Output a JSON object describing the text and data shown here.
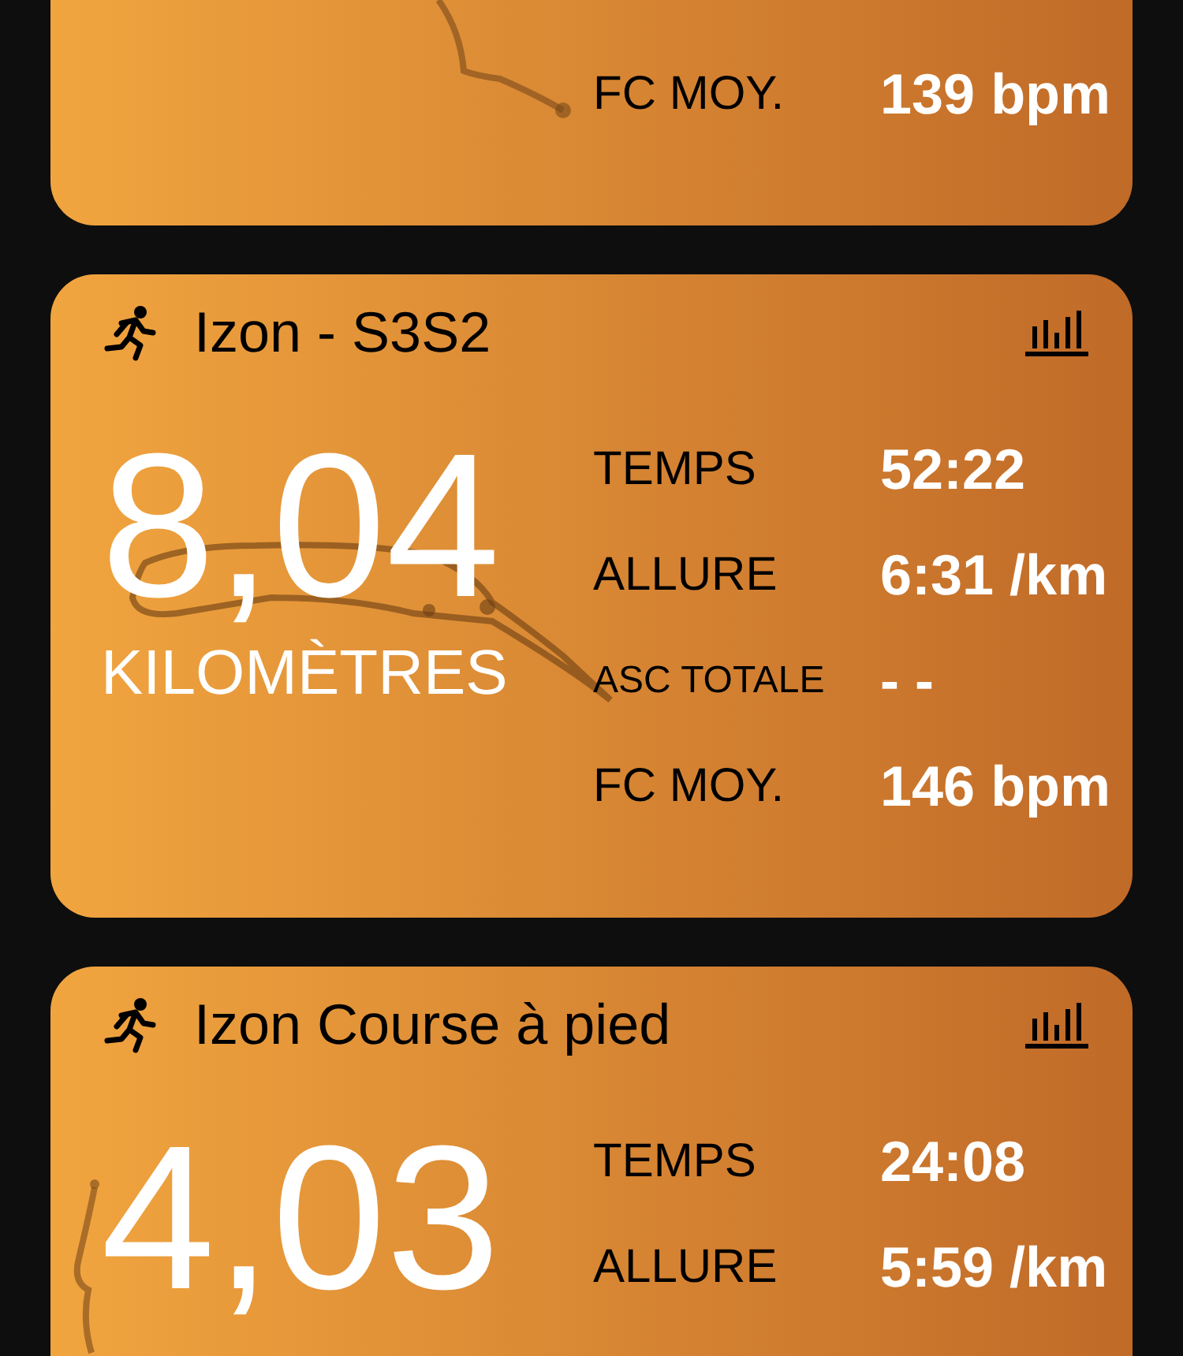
{
  "activities": [
    {
      "stats": [
        {
          "label": "FC MOY.",
          "value": "139 bpm",
          "kind": "normal"
        }
      ]
    },
    {
      "title": "Izon - S3S2",
      "distance": "8,04",
      "unit": "KILOMÈTRES",
      "stats": [
        {
          "label": "TEMPS",
          "value": "52:22",
          "kind": "normal"
        },
        {
          "label": "ALLURE",
          "value": "6:31 /km",
          "kind": "normal"
        },
        {
          "label": "ASC TOTALE",
          "value": "- -",
          "kind": "small"
        },
        {
          "label": "FC MOY.",
          "value": "146 bpm",
          "kind": "normal"
        }
      ]
    },
    {
      "title": "Izon Course à pied",
      "distance": "4,03",
      "stats": [
        {
          "label": "TEMPS",
          "value": "24:08",
          "kind": "normal"
        },
        {
          "label": "ALLURE",
          "value": "5:59 /km",
          "kind": "normal"
        }
      ]
    }
  ]
}
